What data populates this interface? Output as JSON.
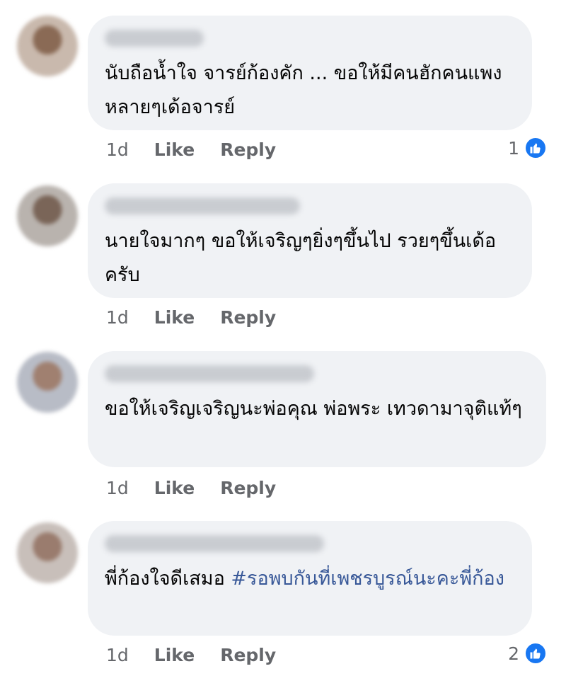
{
  "comments": [
    {
      "text": "นับถือน้ำใจ จารย์ก้องคัก ... ขอให้มีคนฮักคนแพงหลายๆเด้อจารย์",
      "hashtag": "",
      "time": "1d",
      "like_label": "Like",
      "reply_label": "Reply",
      "reaction_count": "1"
    },
    {
      "text": "นายใจมากๆ ขอให้เจริญๆยิ่งๆขึ้นไป รวยๆขึ้นเด้อครับ",
      "hashtag": "",
      "time": "1d",
      "like_label": "Like",
      "reply_label": "Reply",
      "reaction_count": ""
    },
    {
      "text": "ขอให้เจริญเจริญนะพ่อคุณ พ่อพระ เทวดามาจุติแท้ๆ",
      "hashtag": "",
      "time": "1d",
      "like_label": "Like",
      "reply_label": "Reply",
      "reaction_count": ""
    },
    {
      "text": "พี่ก้องใจดีเสมอ ",
      "hashtag": "#รอพบกันที่เพชรบูรณ์นะคะพี่ก้อง",
      "time": "1d",
      "like_label": "Like",
      "reply_label": "Reply",
      "reaction_count": "2"
    }
  ],
  "colors": {
    "bubble": "#f0f2f5",
    "meta_text": "#65676b",
    "hashtag": "#385898",
    "like_badge": "#1877f2"
  },
  "icons": {
    "reaction": "thumbs-up-icon"
  }
}
